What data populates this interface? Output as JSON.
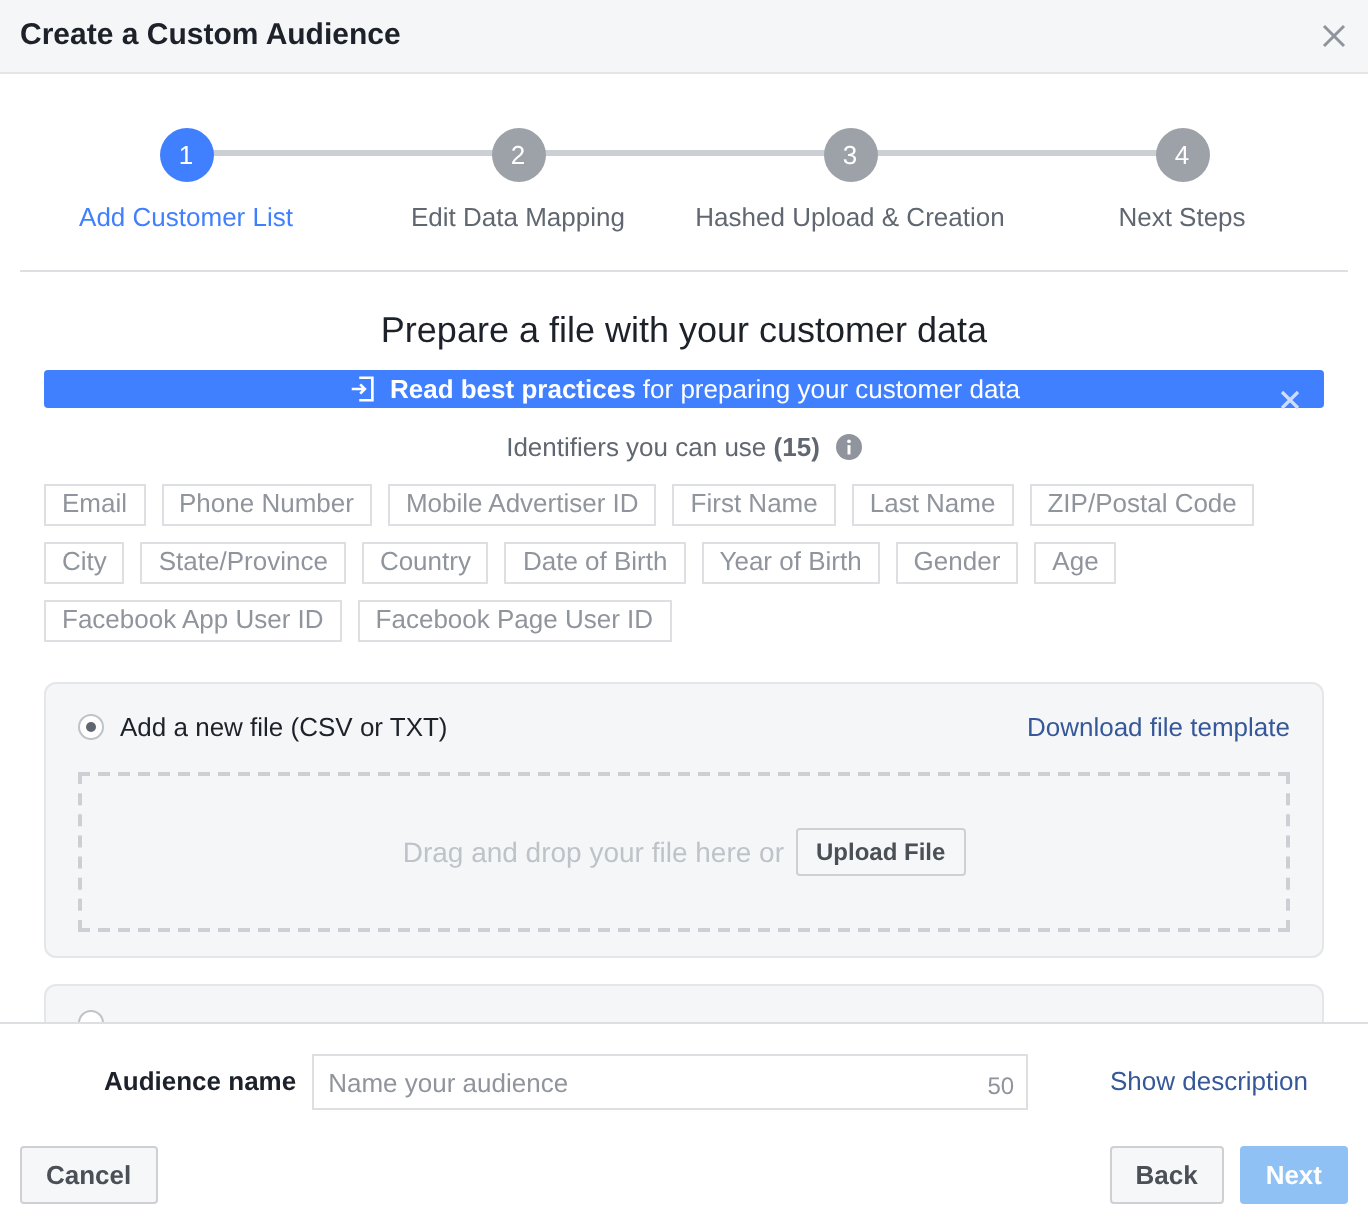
{
  "window": {
    "title": "Create a Custom Audience"
  },
  "steps": [
    {
      "number": "1",
      "label": "Add Customer List",
      "selected": true
    },
    {
      "number": "2",
      "label": "Edit Data Mapping",
      "selected": false
    },
    {
      "number": "3",
      "label": "Hashed Upload & Creation",
      "selected": false
    },
    {
      "number": "4",
      "label": "Next Steps",
      "selected": false
    }
  ],
  "heading": "Prepare a file with your customer data",
  "banner": {
    "text": "**Read best practices** for preparing your customer data"
  },
  "identifiers": {
    "label": "Identifiers you can use **(15)**",
    "items": [
      [
        "Email",
        "Phone Number",
        "Mobile Advertiser ID",
        "First Name",
        "Last Name",
        "ZIP/Postal Code"
      ],
      [
        "City",
        "State/Province",
        "Country",
        "Date of Birth",
        "Year of Birth",
        "Gender",
        "Age"
      ],
      [
        "Facebook App User ID",
        "Facebook Page User ID"
      ]
    ]
  },
  "options": [
    {
      "label": "Add a new file (CSV or TXT)",
      "selected": true,
      "link": "Download file template",
      "drop_text": "Drag and drop your file here or",
      "upload_button": "Upload File"
    },
    {
      "selected": false
    }
  ],
  "audience_name": {
    "label": "Audience name",
    "placeholder": "Name your audience",
    "counter": "50",
    "link": "Show description"
  },
  "buttons": {
    "cancel": "Cancel",
    "back": "Back",
    "next": "Next",
    "next_disabled": true
  }
}
